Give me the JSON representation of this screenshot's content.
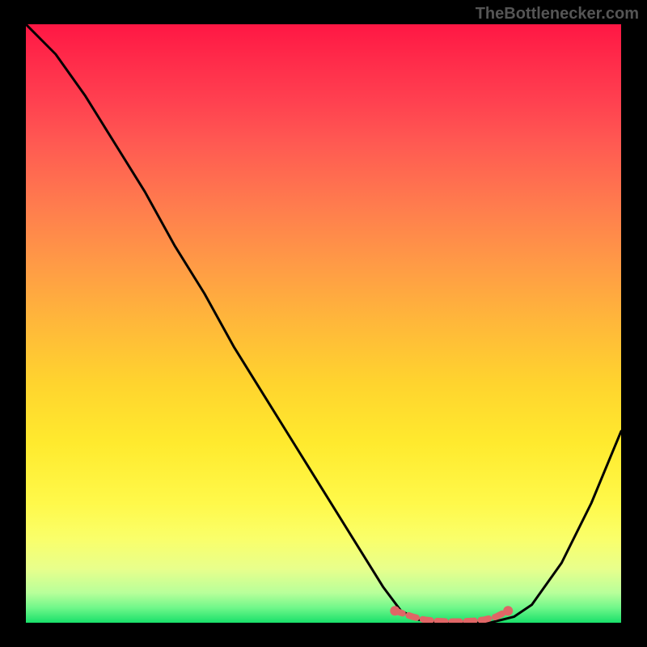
{
  "watermark": "TheBottlenecker.com",
  "chart_data": {
    "type": "line",
    "title": "",
    "xlabel": "",
    "ylabel": "",
    "xlim": [
      0,
      100
    ],
    "ylim": [
      0,
      100
    ],
    "series": [
      {
        "name": "curve",
        "x": [
          0,
          5,
          10,
          15,
          20,
          25,
          30,
          35,
          40,
          45,
          50,
          55,
          60,
          63,
          66,
          70,
          74,
          78,
          82,
          85,
          90,
          95,
          100
        ],
        "y": [
          100,
          95,
          88,
          80,
          72,
          63,
          55,
          46,
          38,
          30,
          22,
          14,
          6,
          2,
          0.5,
          0,
          0,
          0,
          1,
          3,
          10,
          20,
          32
        ]
      }
    ],
    "markers": {
      "name": "highlight",
      "x": [
        62,
        65,
        67,
        69,
        71,
        73,
        75,
        77,
        79,
        81
      ],
      "y": [
        2,
        1,
        0.5,
        0.3,
        0.2,
        0.2,
        0.3,
        0.5,
        1,
        2
      ]
    },
    "gradient_stops": [
      {
        "offset": 0.0,
        "color": "#ff1744"
      },
      {
        "offset": 0.06,
        "color": "#ff2b4a"
      },
      {
        "offset": 0.13,
        "color": "#ff4150"
      },
      {
        "offset": 0.2,
        "color": "#ff5a52"
      },
      {
        "offset": 0.3,
        "color": "#ff7b4e"
      },
      {
        "offset": 0.4,
        "color": "#ff9a46"
      },
      {
        "offset": 0.5,
        "color": "#ffb83a"
      },
      {
        "offset": 0.6,
        "color": "#ffd42e"
      },
      {
        "offset": 0.7,
        "color": "#ffea2e"
      },
      {
        "offset": 0.8,
        "color": "#fff94a"
      },
      {
        "offset": 0.86,
        "color": "#faff6a"
      },
      {
        "offset": 0.91,
        "color": "#e8ff8c"
      },
      {
        "offset": 0.95,
        "color": "#b8ff9a"
      },
      {
        "offset": 0.975,
        "color": "#70f78a"
      },
      {
        "offset": 1.0,
        "color": "#19e06a"
      }
    ]
  }
}
